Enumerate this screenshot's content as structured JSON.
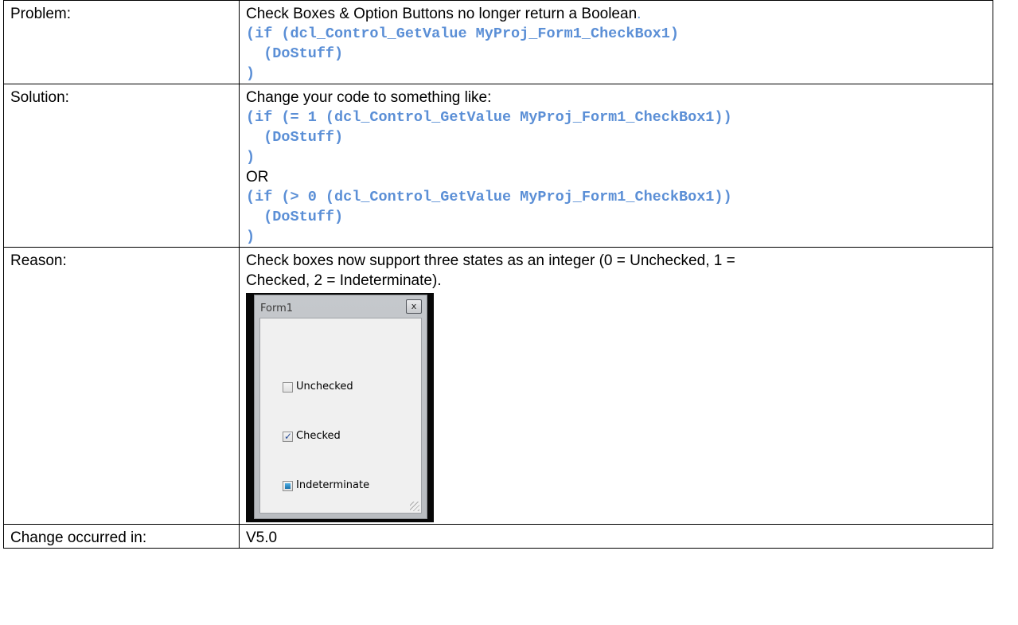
{
  "rows": {
    "problem": {
      "label": "Problem:",
      "text": "Check Boxes & Option Buttons no longer return a Boolean",
      "text_end": ".",
      "code": [
        "(if (dcl_Control_GetValue MyProj_Form1_CheckBox1)",
        "  (DoStuff)",
        ")"
      ]
    },
    "solution": {
      "label": "Solution:",
      "text": "Change your code to something like:",
      "code1": [
        "(if (= 1 (dcl_Control_GetValue MyProj_Form1_CheckBox1))",
        "  (DoStuff)",
        ")"
      ],
      "or": "OR",
      "code2": [
        "(if (> 0 (dcl_Control_GetValue MyProj_Form1_CheckBox1))",
        "  (DoStuff)",
        ")"
      ]
    },
    "reason": {
      "label": "Reason:",
      "text_line1": "Check boxes now support three states as an integer (0 = Unchecked, 1 =",
      "text_line2": "Checked, 2 = Indeterminate).",
      "form": {
        "title": "Form1",
        "close": "x",
        "checkboxes": [
          {
            "label": "Unchecked",
            "state": "unchecked"
          },
          {
            "label": "Checked",
            "state": "checked"
          },
          {
            "label": "Indeterminate",
            "state": "indeterminate"
          }
        ]
      }
    },
    "change": {
      "label": "Change occurred in:",
      "value": "V5.0"
    }
  },
  "colors": {
    "code": "#5b8fd6"
  }
}
